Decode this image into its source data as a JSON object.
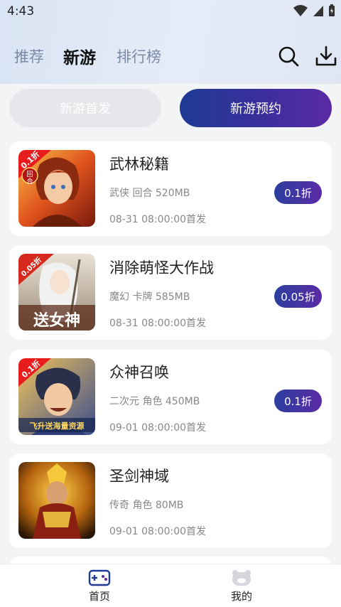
{
  "status_bar": {
    "time": "4:43"
  },
  "top_nav": {
    "tabs": [
      {
        "label": "推荐",
        "active": false
      },
      {
        "label": "新游",
        "active": true
      },
      {
        "label": "排行榜",
        "active": false
      }
    ],
    "search_icon": "search-icon",
    "download_icon": "download-icon"
  },
  "segments": {
    "left": "新游首发",
    "right": "新游预约",
    "selected": "right"
  },
  "games": [
    {
      "name": "武林秘籍",
      "meta": "武侠 回合 520MB",
      "date": "08-31 08:00:00首发",
      "badge": "0.1折",
      "thumb_ribbon": "0.1折",
      "thumb_caption": "回合"
    },
    {
      "name": "消除萌怪大作战",
      "meta": "魔幻 卡牌 585MB",
      "date": "08-31 08:00:00首发",
      "badge": "0.05折",
      "thumb_ribbon": "0.05折",
      "thumb_caption": "送女神"
    },
    {
      "name": "众神召唤",
      "meta": "二次元 角色 450MB",
      "date": "09-01 08:00:00首发",
      "badge": "0.1折",
      "thumb_ribbon": "0.1折",
      "thumb_caption": "飞升送海量资源"
    },
    {
      "name": "圣剑神域",
      "meta": "传奇 角色 80MB",
      "date": "09-01 08:00:00首发",
      "badge": "",
      "thumb_ribbon": "",
      "thumb_caption": ""
    }
  ],
  "bottom_nav": [
    {
      "label": "首页",
      "icon": "gamepad-icon",
      "active": true
    },
    {
      "label": "我的",
      "icon": "bear-face-icon",
      "active": false
    }
  ],
  "colors": {
    "accent_start": "#1e3a94",
    "accent_end": "#5b2aa6",
    "tab_inactive": "#7d8aa6"
  }
}
